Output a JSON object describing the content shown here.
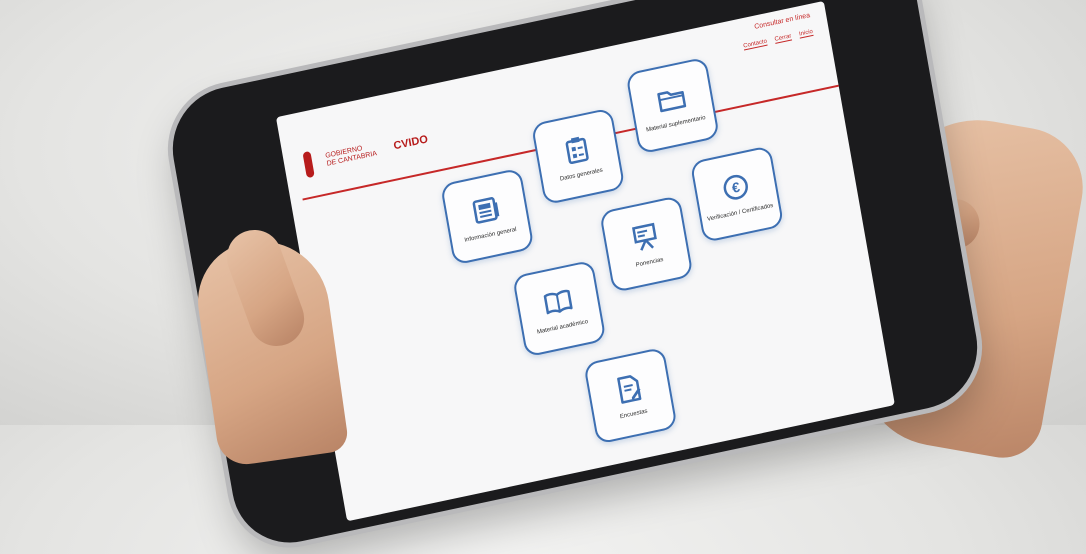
{
  "header": {
    "logo_lines": [
      "GOBIERNO",
      "DE CANTABRIA"
    ],
    "logo_word": "CVIDO",
    "top_title": "Consultar en línea",
    "top_links": [
      "Contacto",
      "Cerrar",
      "Inicio"
    ]
  },
  "tiles": [
    {
      "label": "Información general",
      "icon": "newspaper-icon"
    },
    {
      "label": "Datos generales",
      "icon": "clipboard-icon"
    },
    {
      "label": "Material suplementario",
      "icon": "folder-icon"
    },
    {
      "label": "Material académico",
      "icon": "open-book-icon"
    },
    {
      "label": "Ponencias",
      "icon": "presentation-board-icon"
    },
    {
      "label": "Verificación / Certificados",
      "icon": "euro-icon"
    },
    {
      "label": "Encuestas",
      "icon": "edit-document-icon"
    }
  ],
  "colors": {
    "accent": "#3d6fb2",
    "brand": "#c62828",
    "bezel": "#1b1b1d"
  }
}
